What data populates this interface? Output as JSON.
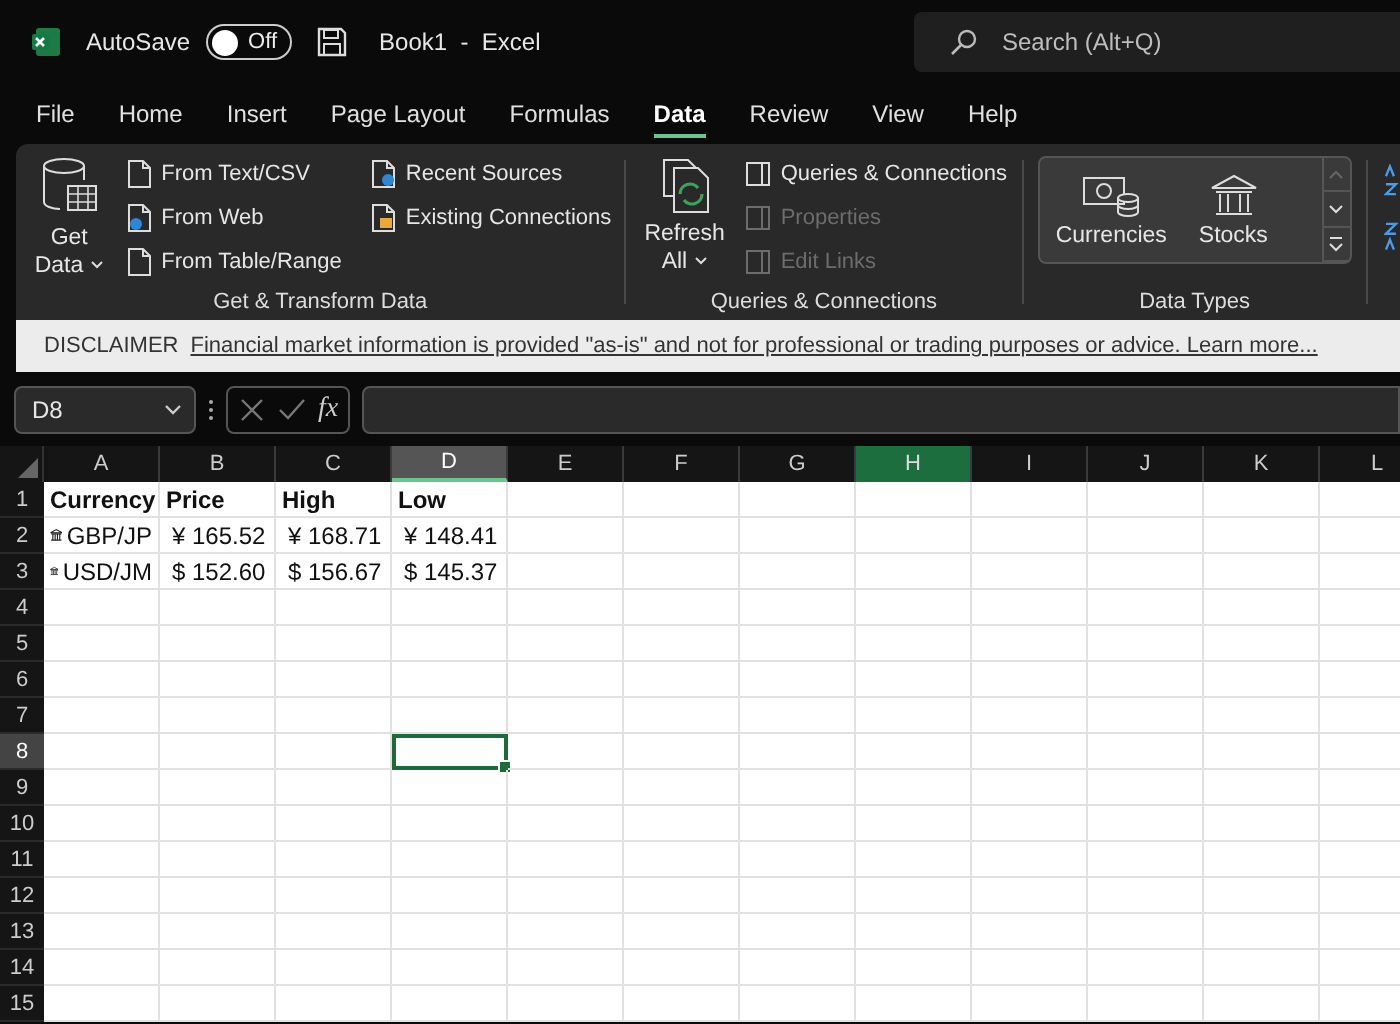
{
  "title_bar": {
    "autosave_label": "AutoSave",
    "autosave": {
      "on": false,
      "label": "Off"
    },
    "document_title": "Book1  -  Excel",
    "search": {
      "placeholder": "Search (Alt+Q)"
    }
  },
  "tabs": [
    {
      "label": "File",
      "selected": false
    },
    {
      "label": "Home",
      "selected": false
    },
    {
      "label": "Insert",
      "selected": false
    },
    {
      "label": "Page Layout",
      "selected": false
    },
    {
      "label": "Formulas",
      "selected": false
    },
    {
      "label": "Data",
      "selected": true
    },
    {
      "label": "Review",
      "selected": false
    },
    {
      "label": "View",
      "selected": false
    },
    {
      "label": "Help",
      "selected": false
    }
  ],
  "ribbon": {
    "groups": [
      {
        "label": "Get & Transform Data",
        "items": [
          {
            "label": "Get Data",
            "kind": "large",
            "disabled": false
          },
          {
            "label": "From Text/CSV",
            "kind": "small",
            "disabled": false
          },
          {
            "label": "From Web",
            "kind": "small",
            "disabled": false
          },
          {
            "label": "From Table/Range",
            "kind": "small",
            "disabled": false
          },
          {
            "label": "Recent Sources",
            "kind": "small",
            "disabled": false
          },
          {
            "label": "Existing Connections",
            "kind": "small",
            "disabled": false
          }
        ]
      },
      {
        "label": "Queries & Connections",
        "items": [
          {
            "label": "Refresh All",
            "kind": "large",
            "disabled": false
          },
          {
            "label": "Queries & Connections",
            "kind": "small",
            "disabled": false
          },
          {
            "label": "Properties",
            "kind": "small",
            "disabled": true
          },
          {
            "label": "Edit Links",
            "kind": "small",
            "disabled": true
          }
        ]
      },
      {
        "label": "Data Types",
        "items": [
          {
            "label": "Currencies",
            "kind": "gallery",
            "disabled": false
          },
          {
            "label": "Stocks",
            "kind": "gallery",
            "disabled": false
          }
        ]
      }
    ]
  },
  "disclaimer": {
    "label": "DISCLAIMER",
    "link": "Financial market information is provided \"as-is\" and not for professional or trading purposes or advice. Learn more..."
  },
  "formula_bar": {
    "name_box": "D8",
    "function_label": "fx"
  },
  "columns": [
    {
      "label": "A",
      "selected": false,
      "highlighted": false
    },
    {
      "label": "B",
      "selected": false,
      "highlighted": false
    },
    {
      "label": "C",
      "selected": false,
      "highlighted": false
    },
    {
      "label": "D",
      "selected": true,
      "highlighted": false
    },
    {
      "label": "E",
      "selected": false,
      "highlighted": false
    },
    {
      "label": "F",
      "selected": false,
      "highlighted": false
    },
    {
      "label": "G",
      "selected": false,
      "highlighted": false
    },
    {
      "label": "H",
      "selected": false,
      "highlighted": true
    },
    {
      "label": "I",
      "selected": false,
      "highlighted": false
    },
    {
      "label": "J",
      "selected": false,
      "highlighted": false
    },
    {
      "label": "K",
      "selected": false,
      "highlighted": false
    },
    {
      "label": "L",
      "selected": false,
      "highlighted": false
    }
  ],
  "rows": [
    {
      "number": "1",
      "selected": false,
      "cells": [
        {
          "text": "Currency",
          "kind": "header"
        },
        {
          "text": "Price",
          "kind": "header"
        },
        {
          "text": "High",
          "kind": "header"
        },
        {
          "text": "Low",
          "kind": "header"
        }
      ]
    },
    {
      "number": "2",
      "selected": false,
      "cells": [
        {
          "text": "GBP/JP",
          "kind": "linked"
        },
        {
          "text": "¥ 165.52",
          "kind": "value"
        },
        {
          "text": "¥ 168.71",
          "kind": "value"
        },
        {
          "text": "¥ 148.41",
          "kind": "value"
        }
      ]
    },
    {
      "number": "3",
      "selected": false,
      "cells": [
        {
          "text": "USD/JM",
          "kind": "linked"
        },
        {
          "text": "$ 152.60",
          "kind": "value"
        },
        {
          "text": "$ 156.67",
          "kind": "value"
        },
        {
          "text": "$ 145.37",
          "kind": "value"
        }
      ]
    },
    {
      "number": "4",
      "selected": false
    },
    {
      "number": "5",
      "selected": false
    },
    {
      "number": "6",
      "selected": false
    },
    {
      "number": "7",
      "selected": false
    },
    {
      "number": "8",
      "selected": true
    },
    {
      "number": "9",
      "selected": false
    },
    {
      "number": "10",
      "selected": false
    },
    {
      "number": "11",
      "selected": false
    },
    {
      "number": "12",
      "selected": false
    },
    {
      "number": "13",
      "selected": false
    },
    {
      "number": "14",
      "selected": false
    },
    {
      "number": "15",
      "selected": false
    }
  ]
}
